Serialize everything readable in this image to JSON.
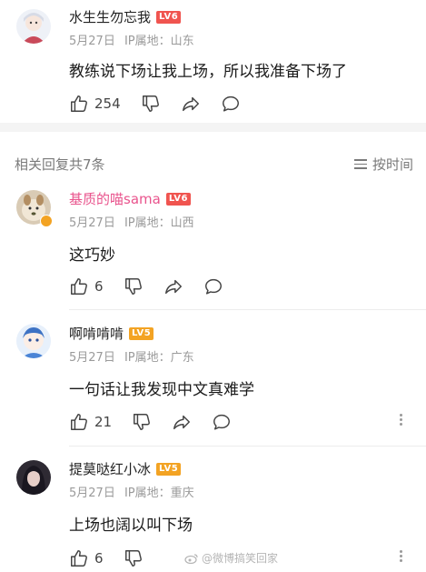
{
  "comments": [
    {
      "username": "水生生勿忘我",
      "level": "LV6",
      "date": "5月27日",
      "ip": "IP属地：山东",
      "text": "教练说下场让我上场，所以我准备下场了",
      "likes": "254"
    },
    {
      "username": "基质的喵sama",
      "level": "LV6",
      "date": "5月27日",
      "ip": "IP属地：山西",
      "text": "这巧妙",
      "likes": "6"
    },
    {
      "username": "啊啃啃啃",
      "level": "LV5",
      "date": "5月27日",
      "ip": "IP属地：广东",
      "text": "一句话让我发现中文真难学",
      "likes": "21"
    },
    {
      "username": "提莫哒红小冰",
      "level": "LV5",
      "date": "5月27日",
      "ip": "IP属地：重庆",
      "text": "上场也阔以叫下场",
      "likes": "6"
    }
  ],
  "replies_header": {
    "title": "相关回复共7条",
    "sort_label": "按时间"
  },
  "watermark": "@微博搞笑回家",
  "colors": {
    "lv6_badge": "#f0544f",
    "lv5_badge": "#f3a323",
    "highlight_username": "#e9548d"
  },
  "icons": [
    "thumbs-up-icon",
    "thumbs-down-icon",
    "share-icon",
    "comment-icon",
    "more-icon",
    "sort-icon"
  ]
}
